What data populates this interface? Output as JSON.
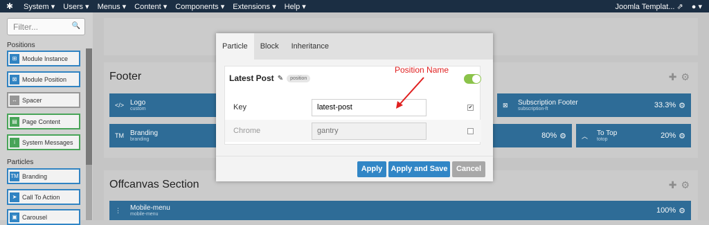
{
  "topbar": {
    "menu": [
      "System ▾",
      "Users ▾",
      "Menus ▾",
      "Content ▾",
      "Components ▾",
      "Extensions ▾",
      "Help ▾"
    ],
    "site": "Joomla Templat...",
    "site_icon": "external-link-icon",
    "user": "▾",
    "user_icon": "user-icon"
  },
  "sidebar": {
    "filter_placeholder": "Filter...",
    "positions_label": "Positions",
    "positions": [
      {
        "label": "Module Instance",
        "icon": "module-icon",
        "color": "blue"
      },
      {
        "label": "Module Position",
        "icon": "position-icon",
        "color": "blue"
      },
      {
        "label": "Spacer",
        "icon": "spacer-icon",
        "color": "grey"
      },
      {
        "label": "Page Content",
        "icon": "page-icon",
        "color": "green"
      },
      {
        "label": "System Messages",
        "icon": "info-icon",
        "color": "green"
      }
    ],
    "particles_label": "Particles",
    "particles": [
      {
        "label": "Branding",
        "icon": "tm-icon",
        "color": "blue"
      },
      {
        "label": "Call To Action",
        "icon": "arrow-icon",
        "color": "blue"
      },
      {
        "label": "Carousel",
        "icon": "image-icon",
        "color": "blue"
      }
    ]
  },
  "layout": {
    "footer": {
      "title": "Footer",
      "blocks": [
        {
          "name": "Logo",
          "sub": "custom",
          "pct": ""
        },
        {
          "name": "Subscription Footer",
          "sub": "subscription-ft",
          "pct": "33.3%"
        },
        {
          "name": "Branding",
          "sub": "branding",
          "pct": "80%"
        },
        {
          "name": "To Top",
          "sub": "totop",
          "pct": "20%"
        }
      ]
    },
    "offcanvas": {
      "title": "Offcanvas Section",
      "blocks": [
        {
          "name": "Mobile-menu",
          "sub": "mobile-menu",
          "pct": "100%"
        }
      ]
    }
  },
  "modal": {
    "tabs": [
      "Particle",
      "Block",
      "Inheritance"
    ],
    "active_tab": "Particle",
    "card": {
      "title": "Latest Post",
      "badge": "position",
      "enabled": true
    },
    "fields": [
      {
        "label": "Key",
        "value": "latest-post",
        "checked": true
      },
      {
        "label": "Chrome",
        "placeholder": "gantry",
        "checked": false
      }
    ],
    "buttons": {
      "apply": "Apply",
      "apply_save": "Apply and Save",
      "cancel": "Cancel"
    }
  },
  "annotation": {
    "text": "Position Name"
  },
  "colors": {
    "topbar": "#1c2f45",
    "block": "#2f6f9b",
    "primary_button": "#3186c6",
    "cancel_button": "#a8a8a8",
    "annotation": "#e02020",
    "toggle": "#8bc34a"
  }
}
